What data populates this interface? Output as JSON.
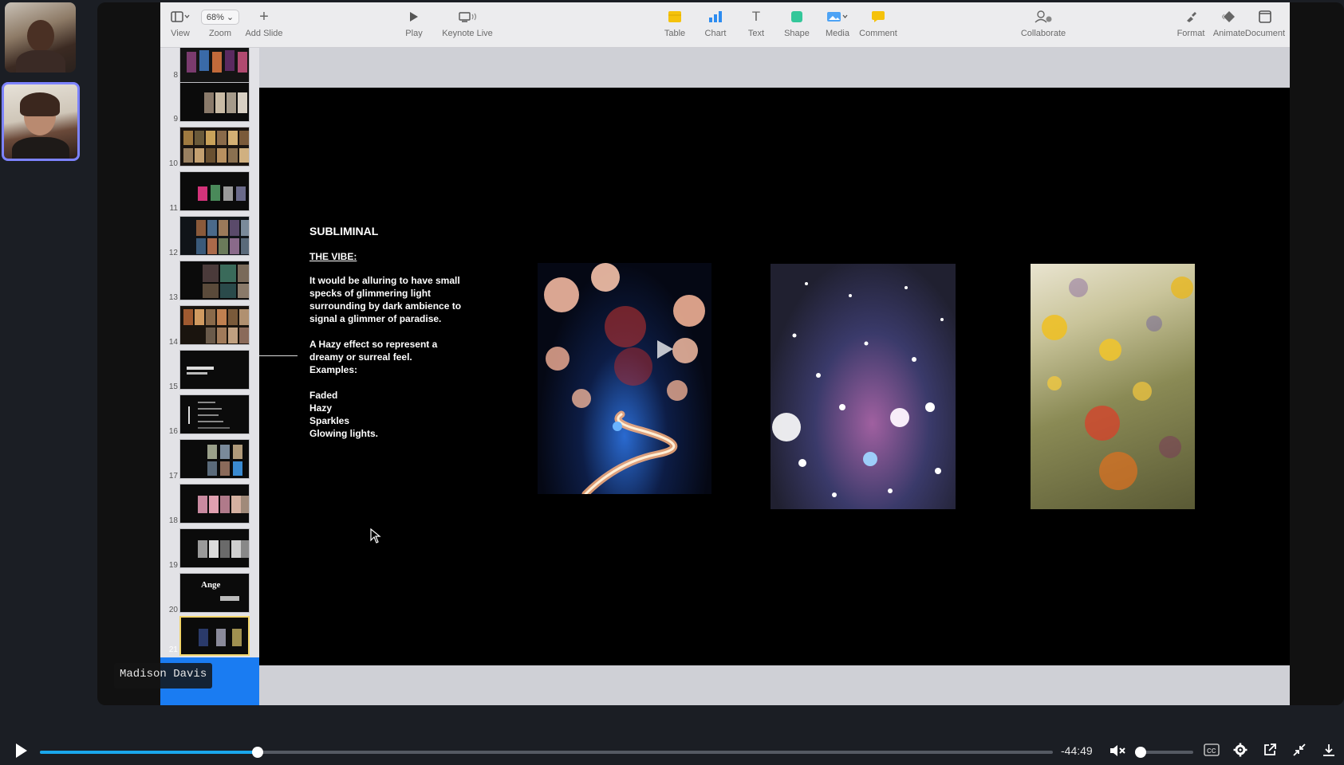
{
  "toolbar": {
    "view_label": "View",
    "zoom_value": "68%",
    "zoom_label": "Zoom",
    "add_slide_label": "Add Slide",
    "play_label": "Play",
    "keynote_live_label": "Keynote Live",
    "table_label": "Table",
    "chart_label": "Chart",
    "text_label": "Text",
    "shape_label": "Shape",
    "media_label": "Media",
    "comment_label": "Comment",
    "collaborate_label": "Collaborate",
    "format_label": "Format",
    "animate_label": "Animate",
    "document_label": "Document"
  },
  "navigator": {
    "slide_numbers": [
      "8",
      "9",
      "10",
      "11",
      "12",
      "13",
      "14",
      "15",
      "16",
      "17",
      "18",
      "19",
      "20",
      "21"
    ],
    "selected": "21",
    "thumb20_text": "Ange"
  },
  "slide": {
    "title": "SUBLIMINAL",
    "subtitle": "THE VIBE:",
    "para1": [
      "It would be alluring to have small",
      "specks of glimmering light",
      "surrounding by dark ambience to",
      "signal a glimmer of paradise."
    ],
    "para2": [
      "A Hazy effect so represent a",
      "dreamy or surreal feel."
    ],
    "examples_label": "Examples:",
    "examples": [
      "Faded",
      "Hazy",
      "Sparkles",
      "Glowing lights."
    ]
  },
  "participant": {
    "name": "Madison Davis"
  },
  "player": {
    "time_remaining": "-44:49",
    "progress": 0.215,
    "volume": 0.0,
    "muted": true
  },
  "colors": {
    "accent": "#1aa7ec",
    "selection": "#1a7cf2",
    "tile_border": "#7d83ff"
  }
}
